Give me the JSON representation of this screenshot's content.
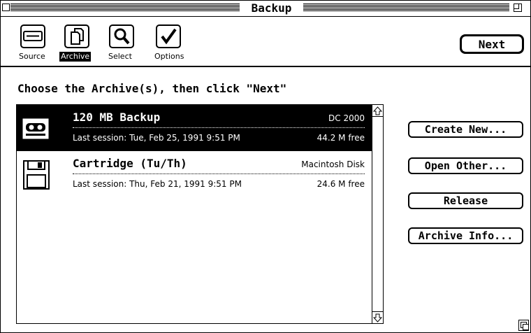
{
  "window": {
    "title": "Backup"
  },
  "toolbar": {
    "tools": [
      {
        "label": "Source",
        "icon": "drive-icon",
        "selected": false
      },
      {
        "label": "Archive",
        "icon": "documents-icon",
        "selected": true
      },
      {
        "label": "Select",
        "icon": "magnifier-icon",
        "selected": false
      },
      {
        "label": "Options",
        "icon": "checkmark-icon",
        "selected": false
      }
    ],
    "next_label": "Next"
  },
  "main": {
    "instruction": "Choose the Archive(s), then click \"Next\"",
    "archives": [
      {
        "name": "120 MB Backup",
        "type": "DC 2000",
        "session": "Last session: Tue, Feb 25, 1991  9:51 PM",
        "free": "44.2 M  free",
        "icon": "tape-cartridge-icon",
        "selected": true
      },
      {
        "name": "Cartridge (Tu/Th)",
        "type": "Macintosh Disk",
        "session": "Last session: Thu, Feb 21, 1991  9:51 PM",
        "free": "24.6 M  free",
        "icon": "floppy-disk-icon",
        "selected": false
      }
    ],
    "buttons": {
      "create_new": "Create New...",
      "open_other": "Open Other...",
      "release": "Release",
      "archive_info": "Archive Info..."
    }
  }
}
